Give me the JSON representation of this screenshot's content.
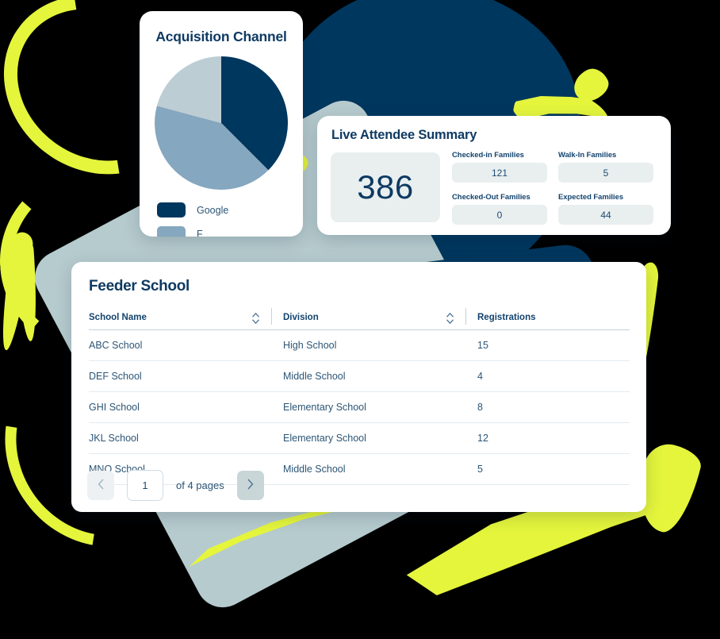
{
  "acquisition": {
    "title": "Acquisition Channel",
    "legend": [
      {
        "label": "Google",
        "color": "#00375E"
      },
      {
        "label": "F",
        "color": "#85A7BF"
      }
    ]
  },
  "live_summary": {
    "title": "Live Attendee Summary",
    "total": "386",
    "stats": [
      {
        "label": "Checked-in Families",
        "value": "121"
      },
      {
        "label": "Walk-In Families",
        "value": "5"
      },
      {
        "label": "Checked-Out Families",
        "value": "0"
      },
      {
        "label": "Expected Families",
        "value": "44"
      }
    ]
  },
  "feeder": {
    "title": "Feeder School",
    "columns": [
      "School Name",
      "Division",
      "Registrations"
    ],
    "rows": [
      {
        "school": "ABC School",
        "division": "High School",
        "registrations": "15"
      },
      {
        "school": "DEF School",
        "division": "Middle School",
        "registrations": "4"
      },
      {
        "school": "GHI School",
        "division": "Elementary School",
        "registrations": "8"
      },
      {
        "school": "JKL School",
        "division": "Elementary School",
        "registrations": "12"
      },
      {
        "school": "MNO School",
        "division": "Middle School",
        "registrations": "5"
      }
    ],
    "pagination": {
      "current_page": "1",
      "of_text": "of 4 pages",
      "prev_icon": "chevron-left-icon",
      "next_icon": "chevron-right-icon"
    }
  },
  "colors": {
    "navy": "#00375E",
    "mid_blue": "#85A7BF",
    "light_blue": "#BDCDD4",
    "gray_blue": "#B6CBCE",
    "accent_yellow": "#E4F53C",
    "panel_gray": "#E9EFEF"
  },
  "chart_data": {
    "type": "pie",
    "title": "Acquisition Channel",
    "labels": [
      "Google",
      "F"
    ],
    "values": [
      37.5,
      33.3,
      29.2
    ],
    "slices": [
      {
        "label": "Google",
        "percent": 37.5,
        "color": "#00375E",
        "start_deg": 0,
        "end_deg": 135
      },
      {
        "label": "F",
        "percent": 33.3,
        "color": "#85A7BF",
        "start_deg": 135,
        "end_deg": 255
      },
      {
        "label": "",
        "percent": 29.2,
        "color": "#BDCDD4",
        "start_deg": 255,
        "end_deg": 360
      }
    ],
    "legend_position": "bottom-left",
    "grid": false
  }
}
